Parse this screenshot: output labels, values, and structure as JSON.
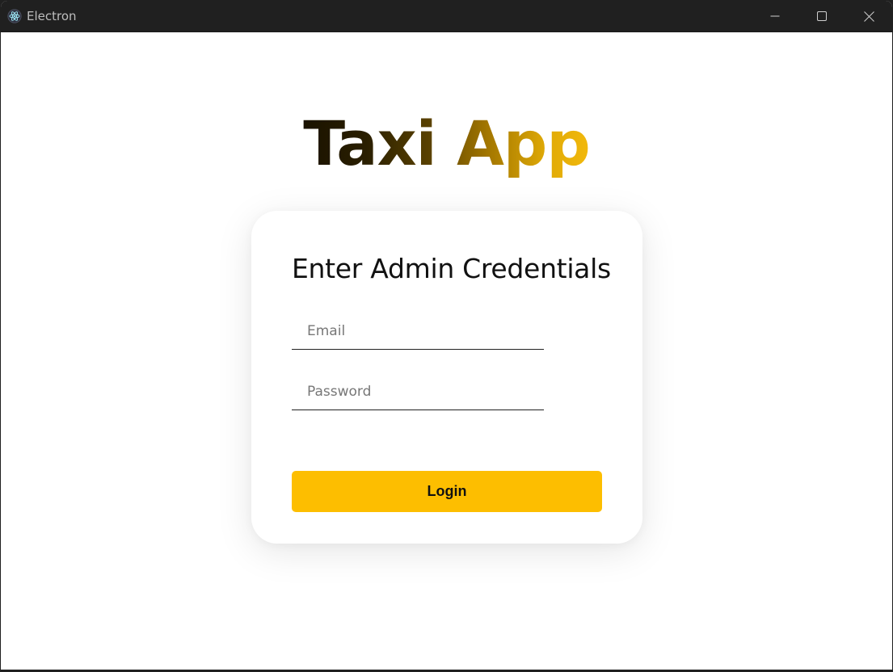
{
  "window": {
    "title": "Electron",
    "controls": {
      "minimize_icon": "minimize-icon",
      "maximize_icon": "maximize-icon",
      "close_icon": "close-icon"
    }
  },
  "app": {
    "brand": "Taxi App",
    "brand_gradient": [
      "#1a1200",
      "#f2b90c"
    ]
  },
  "login": {
    "title": "Enter Admin Credentials",
    "email": {
      "placeholder": "Email",
      "value": ""
    },
    "password": {
      "placeholder": "Password",
      "value": ""
    },
    "submit_label": "Login",
    "submit_color": "#fdbe00"
  }
}
